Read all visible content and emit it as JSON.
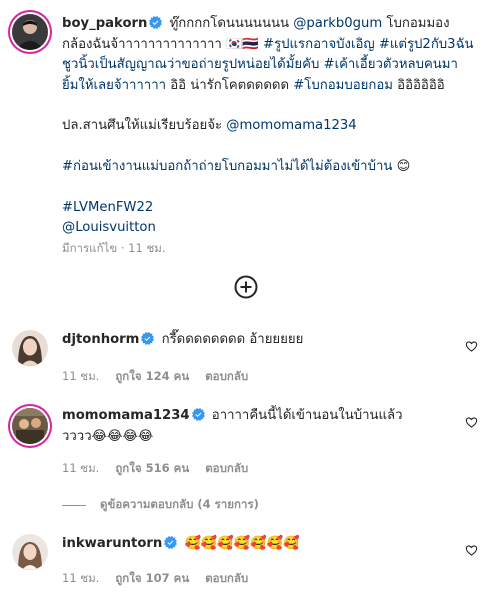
{
  "caption": {
    "username": "boy_pakorn",
    "text_a": "ทู๊กกกกโดนนนนนนน ",
    "mention_1": "@parkb0gum",
    "text_b": " โบกอมมองกล้องฉันจ้าาาาาาาาาาาาาา 🇰🇷🇹🇭 ",
    "tag_1": "#รูปแรกอาจบังเอิญ",
    "text_c": " ",
    "tag_2": "#แต่รูป2กับ3ฉันชูวนิ้วเป็นสัญญาณว่าขอถ่ายรูปหน่อยได้มั้ยคับ",
    "text_d": " ",
    "tag_3": "#เค้าเอี้ยวตัวหลบคนมายิ้มให้เลยจ้าาาาาา",
    "text_e": " อิอิ น่ารักโคตดดดดด ",
    "tag_4": "#โบกอมบอยกอม",
    "text_f": " อิอิอิอิอิอิ",
    "line2_text": "ปล.สานศึนให้แม่เรียบร้อยจ้ะ ",
    "line2_mention": "@momomama1234",
    "line3_tag": "#ก่อนเข้างานแม่บอกถ้าถ่ายโบกอมมาไม่ได้ไม่ต้องเข้าบ้าน",
    "line3_emoji": " 😊",
    "tag_lv": "#LVMenFW22",
    "mention_lv": "@Louisvuitton",
    "edited": "มีการแก้ไข · 11 ชม."
  },
  "comments": [
    {
      "username": "djtonhorm",
      "text": "กรี๊ดดดดดดดด อ้ายยยยย",
      "time": "11 ชม.",
      "likes": "ถูกใจ 124 คน",
      "reply": "ตอบกลับ"
    },
    {
      "username": "momomama1234",
      "text": "อาาาาคืนนี้ได้เข้านอนในบ้านแล้ววววว😂😂😂😂",
      "time": "11 ชม.",
      "likes": "ถูกใจ 516 คน",
      "reply": "ตอบกลับ",
      "view_replies": "ดูข้อความตอบกลับ (4 รายการ)"
    },
    {
      "username": "inkwaruntorn",
      "text": "🥰🥰🥰🥰🥰🥰🥰",
      "time": "11 ชม.",
      "likes": "ถูกใจ 107 คน",
      "reply": "ตอบกลับ"
    }
  ],
  "colors": {
    "text": "#262626",
    "link": "#00376b",
    "muted": "#8e8e8e",
    "verified": "#3897f0"
  },
  "icons": [
    "verified-badge-icon",
    "plus-circle-icon",
    "heart-outline-icon"
  ]
}
